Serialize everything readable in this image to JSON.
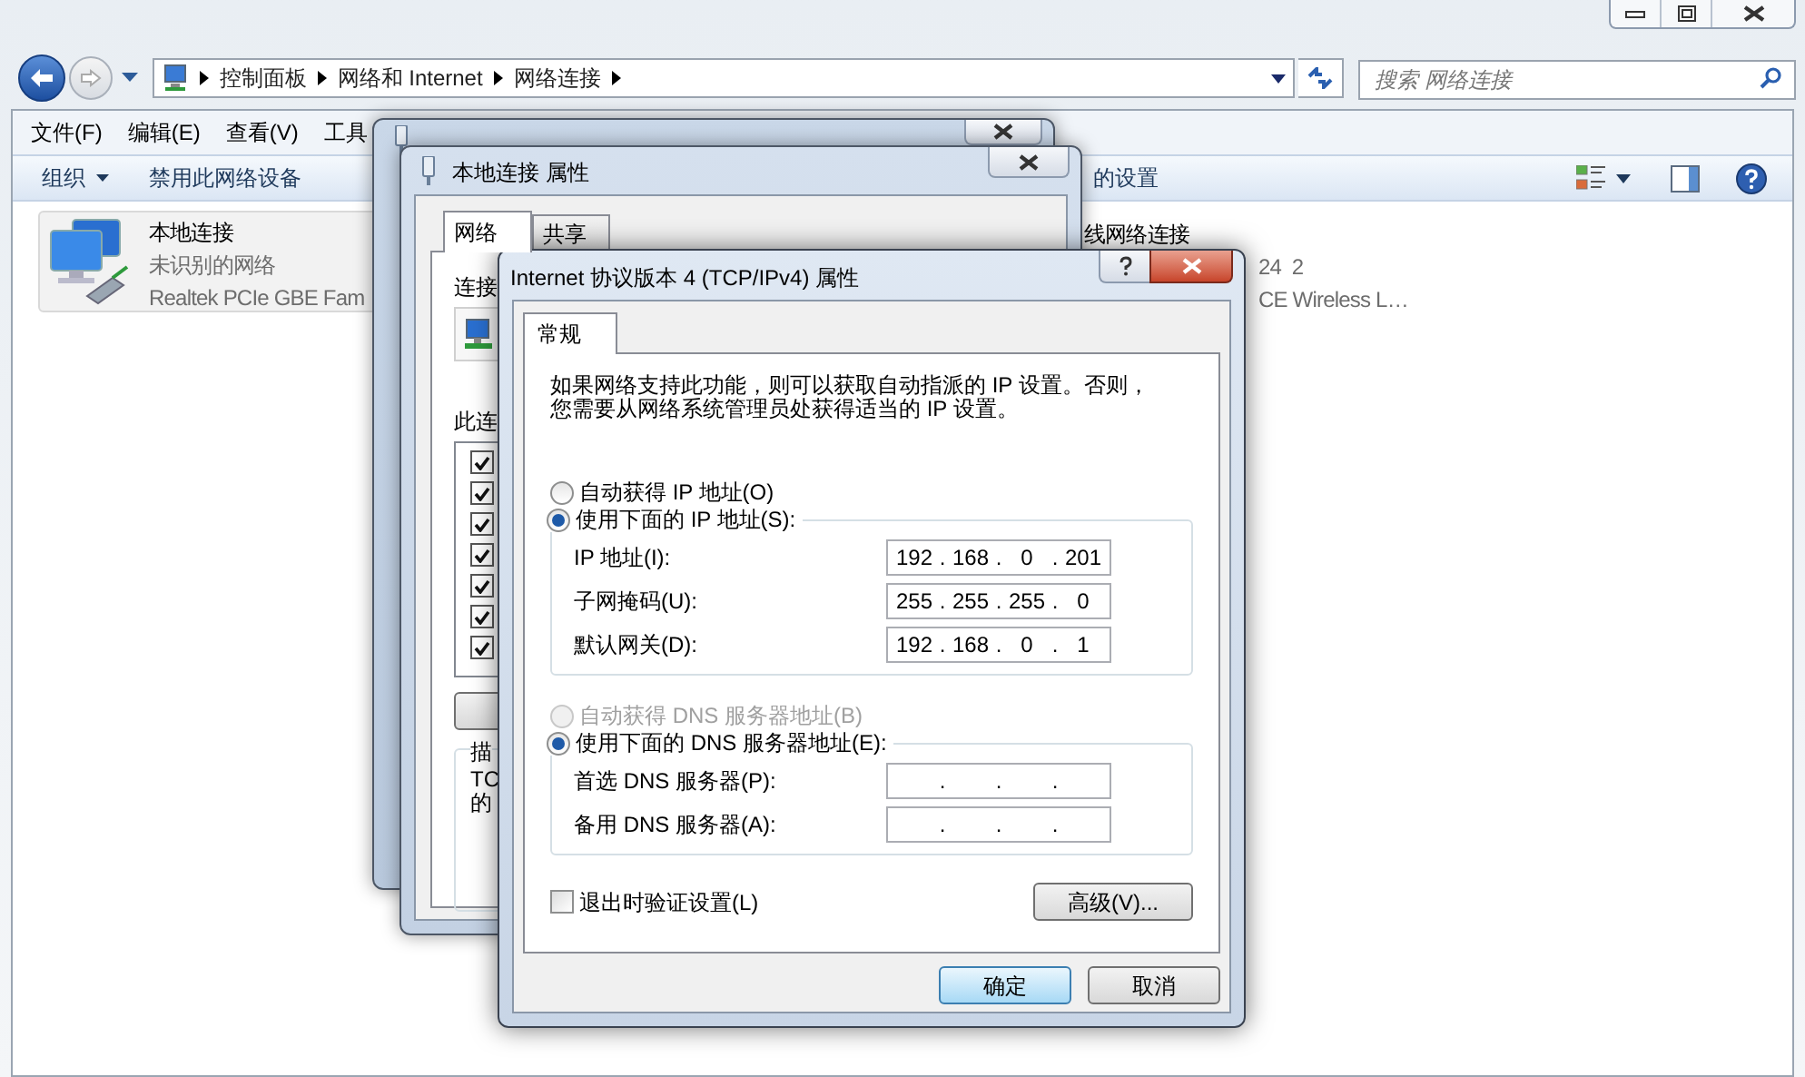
{
  "explorer": {
    "breadcrumb": [
      "控制面板",
      "网络和 Internet",
      "网络连接"
    ],
    "search": {
      "placeholder": "搜索 网络连接"
    },
    "menu": [
      "文件(F)",
      "编辑(E)",
      "查看(V)",
      "工具"
    ],
    "toolbar": [
      {
        "label": "组织",
        "dropdown": true
      },
      {
        "label": "禁用此网络设备",
        "dropdown": false
      },
      {
        "label": "的设置",
        "dropdown": false
      }
    ],
    "connections": [
      {
        "name": "本地连接",
        "status": "未识别的网络",
        "device": "Realtek PCIe GBE Fam",
        "icon": true
      },
      {
        "name": "线网络连接",
        "status": "24  2",
        "device": "CE Wireless L…",
        "icon": false
      }
    ]
  },
  "properties_dialog": {
    "title": "本地连接 属性",
    "tabs": [
      {
        "label": "网络",
        "selected": true
      },
      {
        "label": "共享",
        "selected": false
      }
    ],
    "connect_label": "连接",
    "items_label": "此连",
    "items": [
      {
        "checked": true
      },
      {
        "checked": true
      },
      {
        "checked": true
      },
      {
        "checked": true
      },
      {
        "checked": true
      },
      {
        "checked": true
      },
      {
        "checked": true
      }
    ],
    "description_label": "描",
    "description_lines": [
      "TC",
      "的"
    ]
  },
  "ipv4_dialog": {
    "title": "Internet 协议版本 4 (TCP/IPv4) 属性",
    "tabs": [
      {
        "label": "常规",
        "selected": true
      }
    ],
    "intro": "如果网络支持此功能，则可以获取自动指派的 IP 设置。否则，您需要从网络系统管理员处获得适当的 IP 设置。",
    "ip_options": [
      {
        "label": "自动获得 IP 地址(O)",
        "selected": false,
        "disabled": false
      },
      {
        "label": "使用下面的 IP 地址(S):",
        "selected": true,
        "disabled": false
      }
    ],
    "ip_fields": [
      {
        "label": "IP 地址(I):",
        "octets": [
          "192",
          "168",
          "0",
          "201"
        ]
      },
      {
        "label": "子网掩码(U):",
        "octets": [
          "255",
          "255",
          "255",
          "0"
        ]
      },
      {
        "label": "默认网关(D):",
        "octets": [
          "192",
          "168",
          "0",
          "1"
        ]
      }
    ],
    "dns_options": [
      {
        "label": "自动获得 DNS 服务器地址(B)",
        "selected": false,
        "disabled": true
      },
      {
        "label": "使用下面的 DNS 服务器地址(E):",
        "selected": true,
        "disabled": false
      }
    ],
    "dns_fields": [
      {
        "label": "首选 DNS 服务器(P):"
      },
      {
        "label": "备用 DNS 服务器(A):"
      }
    ],
    "validate": {
      "label": "退出时验证设置(L)",
      "checked": false
    },
    "advanced_button": "高级(V)...",
    "octet_separator": ".",
    "buttons": [
      {
        "label": "确定",
        "default": true
      },
      {
        "label": "取消",
        "default": false
      }
    ]
  }
}
